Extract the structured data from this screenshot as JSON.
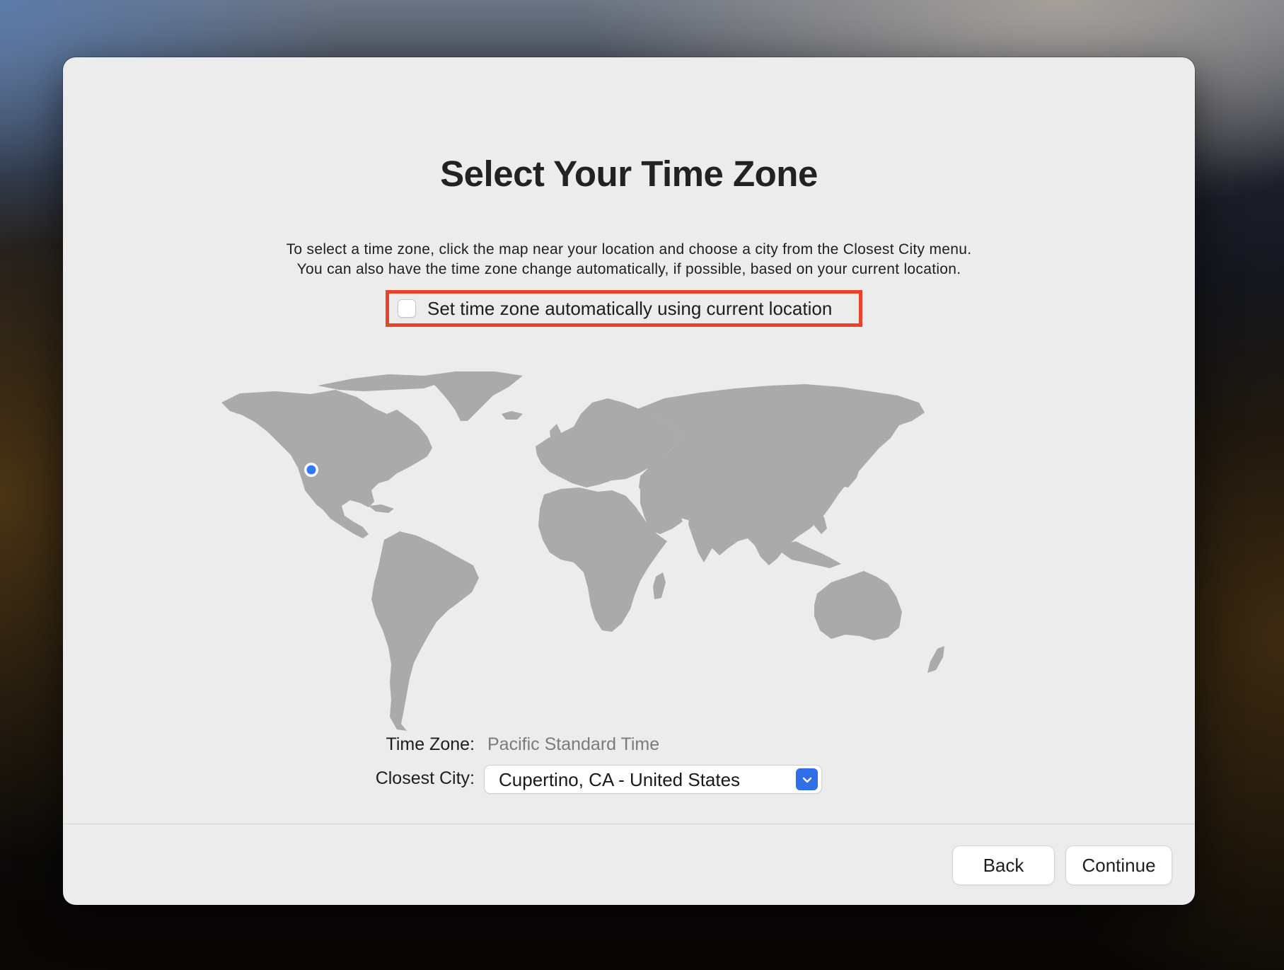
{
  "page": {
    "title": "Select Your Time Zone",
    "description_line1": "To select a time zone, click the map near your location and choose a city from the Closest City menu.",
    "description_line2": "You can also have the time zone change automatically, if possible, based on your current location."
  },
  "auto_timezone": {
    "label": "Set time zone automatically using current location",
    "checked": false
  },
  "map": {
    "land_color": "#aaaaaa",
    "marker_color": "#2f7bf0"
  },
  "time_zone": {
    "label": "Time Zone:",
    "value": "Pacific Standard Time"
  },
  "closest_city": {
    "label": "Closest City:",
    "selected": "Cupertino, CA - United States"
  },
  "buttons": {
    "back": "Back",
    "continue": "Continue"
  },
  "colors": {
    "highlight": "#e8442b",
    "accent": "#2f6ee6"
  }
}
